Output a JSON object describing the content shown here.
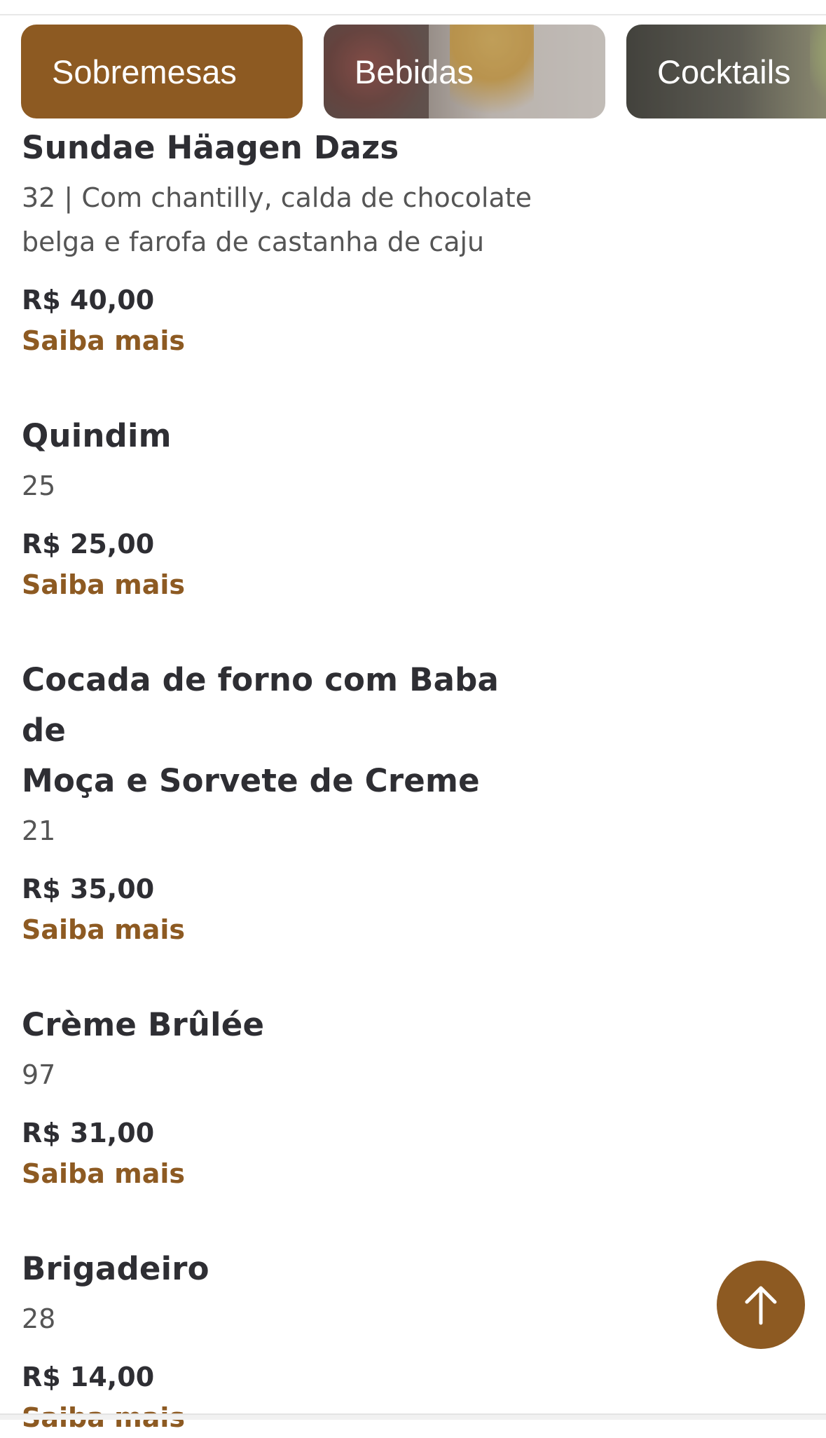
{
  "tabs": [
    {
      "label": "Sobremesas",
      "active": true
    },
    {
      "label": "Bebidas",
      "active": false
    },
    {
      "label": "Cocktails",
      "active": false
    }
  ],
  "items": [
    {
      "name_lines": [
        "Sundae Häagen Dazs"
      ],
      "desc_lines": [
        "32 | Com chantilly, calda de chocolate",
        "belga e farofa de castanha de caju"
      ],
      "price": "R$ 40,00",
      "more": "Saiba mais"
    },
    {
      "name_lines": [
        "Quindim"
      ],
      "desc_lines": [
        "25"
      ],
      "price": "R$ 25,00",
      "more": "Saiba mais"
    },
    {
      "name_lines": [
        "Cocada de forno com Baba de",
        "Moça e Sorvete de Creme"
      ],
      "desc_lines": [
        "21"
      ],
      "price": "R$ 35,00",
      "more": "Saiba mais"
    },
    {
      "name_lines": [
        "Crème Brûlée"
      ],
      "desc_lines": [
        "97"
      ],
      "price": "R$ 31,00",
      "more": "Saiba mais"
    },
    {
      "name_lines": [
        "Brigadeiro"
      ],
      "desc_lines": [
        "28"
      ],
      "price": "R$ 14,00",
      "more": "Saiba mais"
    }
  ],
  "scroll_top": {
    "icon": "arrow-up-icon"
  },
  "colors": {
    "accent": "#8d5a22",
    "text": "#2e2e33",
    "muted": "#555555"
  }
}
